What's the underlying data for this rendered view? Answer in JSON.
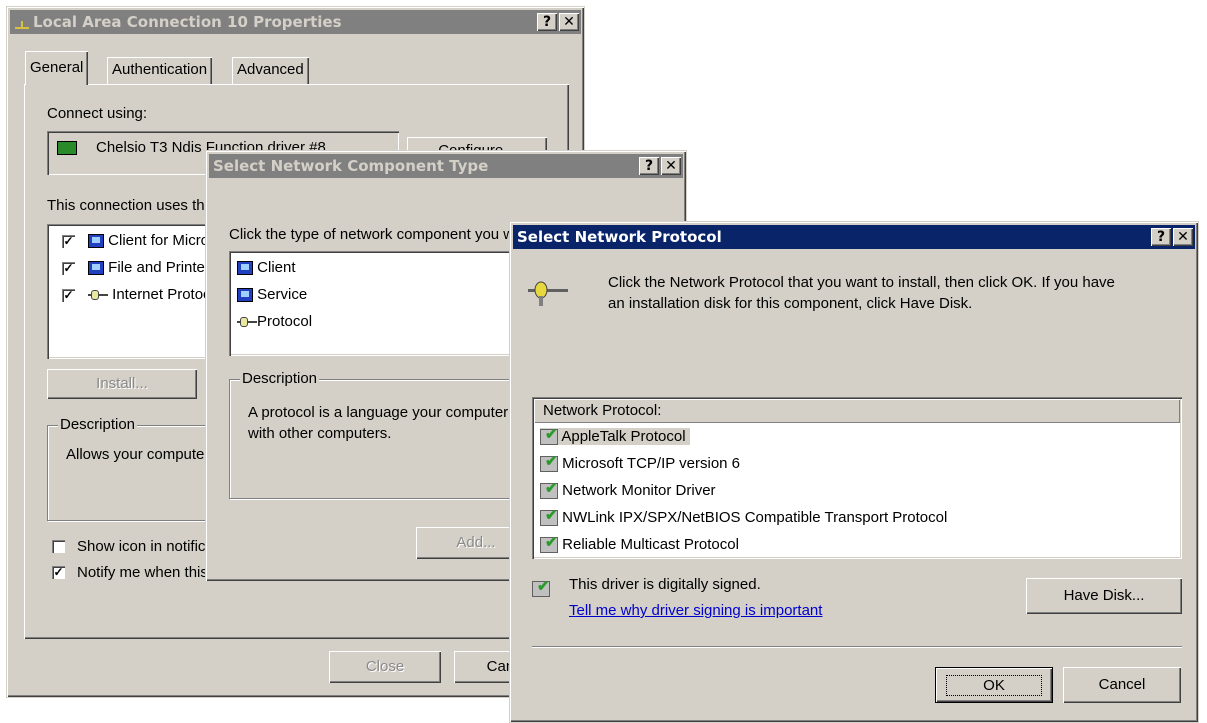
{
  "win1": {
    "title": "Local Area Connection 10 Properties",
    "help": "?",
    "close": "✕",
    "tabs": [
      "General",
      "Authentication",
      "Advanced"
    ],
    "connect_using": "Connect using:",
    "adapter": "Chelsio T3 Ndis Function driver #8",
    "configure": "Configure...",
    "uses_label": "This connection uses the following items:",
    "items": [
      "Client for Microsoft Networks",
      "File and Printer Sharing for Microsoft Networks",
      "Internet Protocol (TCP/IP)"
    ],
    "install": "Install...",
    "description_label": "Description",
    "description": "Allows your computer to access resources on a Microsoft network.",
    "show_icon": "Show icon in notification area when connected",
    "notify": "Notify me when this connection has limited or no connectivity",
    "close_btn": "Close",
    "cancel_btn": "Cancel"
  },
  "win2": {
    "title": "Select Network Component Type",
    "help": "?",
    "close": "✕",
    "prompt": "Click the type of network component you want to install:",
    "components": [
      "Client",
      "Service",
      "Protocol"
    ],
    "description_label": "Description",
    "description": "A protocol is a language your computer uses to communicate with other computers.",
    "add": "Add..."
  },
  "win3": {
    "title": "Select Network Protocol",
    "help": "?",
    "close": "✕",
    "instructions_line1": "Click the Network Protocol that you want to install, then click OK. If you have",
    "instructions_line2": "an installation disk for this component, click Have Disk.",
    "list_header": "Network Protocol:",
    "protocols": [
      "AppleTalk Protocol",
      "Microsoft TCP/IP version 6",
      "Network Monitor Driver",
      "NWLink IPX/SPX/NetBIOS Compatible Transport Protocol",
      "Reliable Multicast Protocol"
    ],
    "signed": "This driver is digitally signed.",
    "signing_link": "Tell me why driver signing is important",
    "have_disk": "Have Disk...",
    "ok": "OK",
    "cancel": "Cancel"
  },
  "colors": {
    "face": "#d4d0c8",
    "active_title": "#0a246a",
    "inactive_title": "#808080",
    "link": "#0000cc"
  }
}
